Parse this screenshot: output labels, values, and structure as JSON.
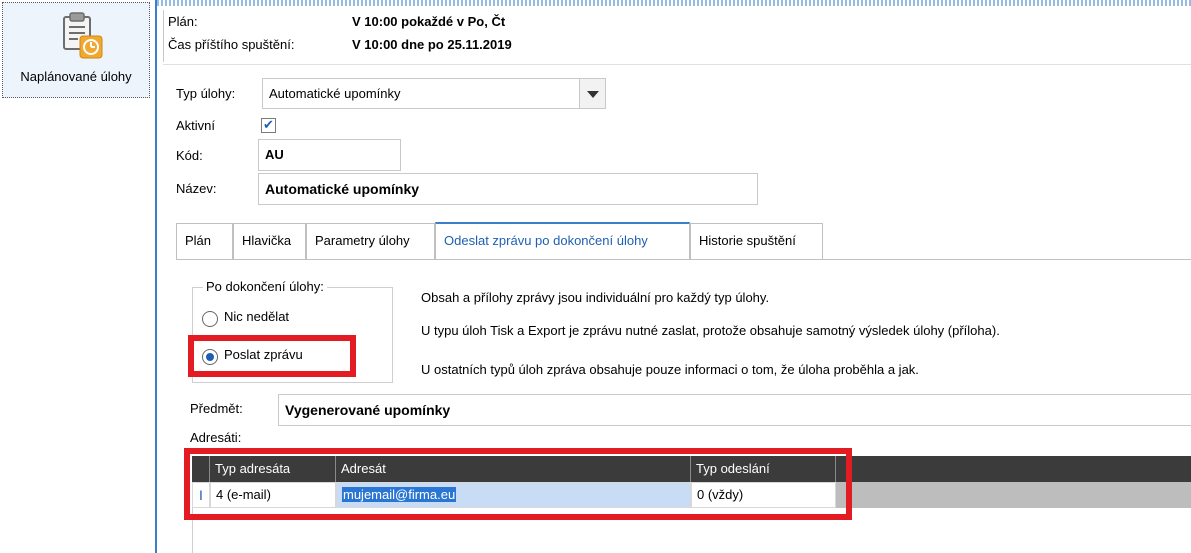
{
  "nav": {
    "item_label": "Naplánované úlohy",
    "icon": "scheduled-task-clock-icon"
  },
  "header": {
    "plan_label": "Plán:",
    "plan_value": "V 10:00 pokaždé v Po, Čt",
    "next_label": "Čas příštího spuštění:",
    "next_value": "V 10:00 dne po 25.11.2019"
  },
  "form": {
    "typ_label": "Typ úlohy:",
    "typ_value": "Automatické upomínky",
    "aktivni_label": "Aktivní",
    "aktivni_checked": true,
    "kod_label": "Kód:",
    "kod_value": "AU",
    "nazev_label": "Název:",
    "nazev_value": "Automatické upomínky"
  },
  "tabs": [
    {
      "label": "Plán",
      "active": false
    },
    {
      "label": "Hlavička",
      "active": false
    },
    {
      "label": "Parametry úlohy",
      "active": false
    },
    {
      "label": "Odeslat zprávu po dokončení úlohy",
      "active": true
    },
    {
      "label": "Historie spuštění",
      "active": false
    }
  ],
  "completion": {
    "group_label": "Po dokončení úlohy:",
    "option_nothing": "Nic nedělat",
    "option_send": "Poslat zprávu",
    "selected": "send",
    "info_1": "Obsah a přílohy zprávy jsou individuální pro každý typ úlohy.",
    "info_2": "U typu úloh Tisk a Export je zprávu nutné zaslat, protože obsahuje samotný výsledek úlohy (příloha).",
    "info_3": "U ostatních typů úloh zpráva obsahuje pouze informaci o tom, že úloha proběhla a jak."
  },
  "message": {
    "predmet_label": "Předmět:",
    "predmet_value": "Vygenerované upomínky",
    "adresati_label": "Adresáti:"
  },
  "grid": {
    "columns": [
      "Typ adresáta",
      "Adresát",
      "Typ odeslání"
    ],
    "rows": [
      {
        "indicator": "I",
        "typ": "4 (e-mail)",
        "adresat": "mujemail@firma.eu",
        "odeslani": "0 (vždy)"
      }
    ]
  },
  "colors": {
    "accent": "#3a7fc7",
    "highlight": "#e31b23",
    "grid_header": "#3b3b3b"
  }
}
